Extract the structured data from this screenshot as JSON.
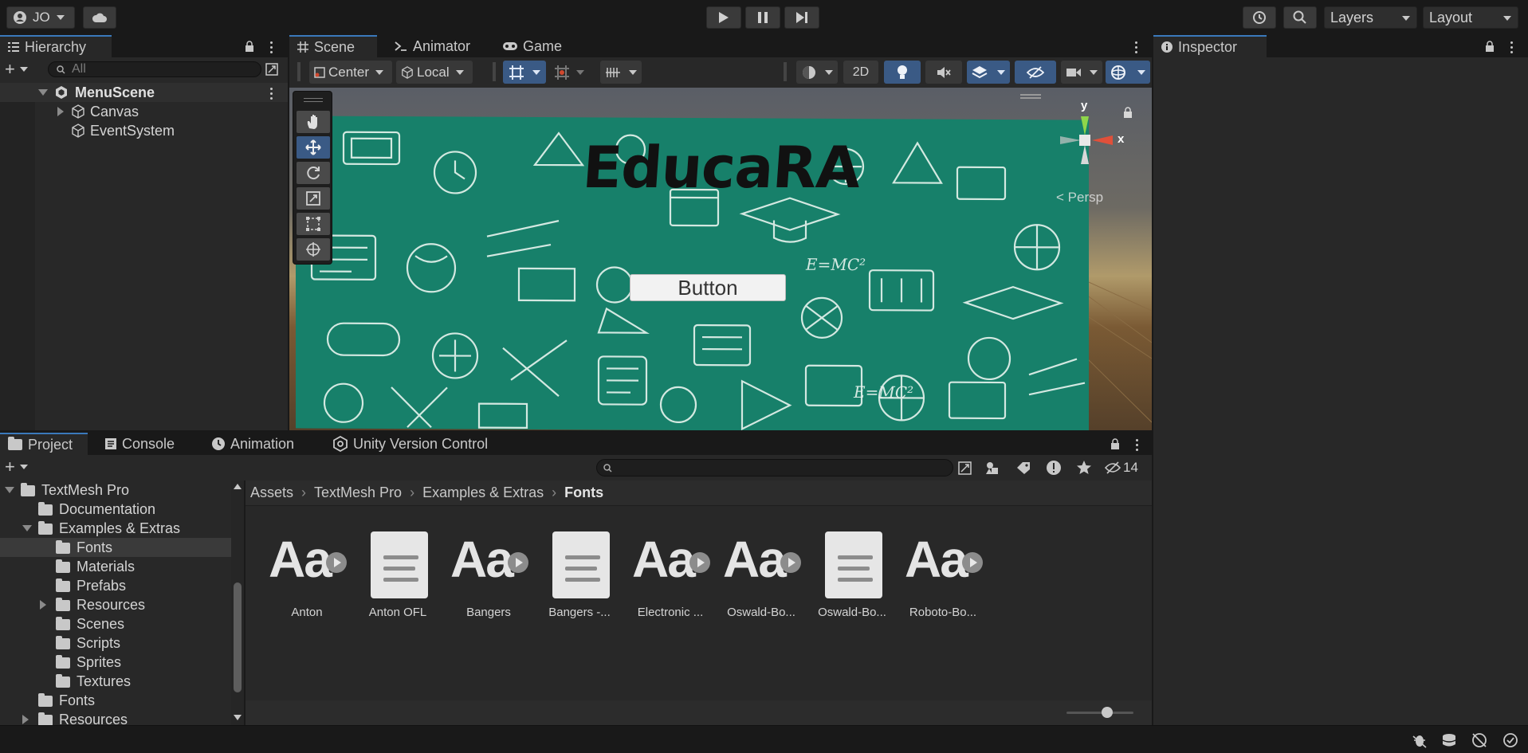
{
  "toolbar": {
    "account_label": "JO",
    "account_icon": "account-icon",
    "cloud_icon": "cloud-icon",
    "play_icon": "play-icon",
    "pause_icon": "pause-icon",
    "step_icon": "step-icon",
    "history_icon": "history-icon",
    "search_icon": "search-icon",
    "layers_label": "Layers",
    "layout_label": "Layout"
  },
  "hierarchy": {
    "tab_label": "Hierarchy",
    "search_placeholder": "All",
    "scene_name": "MenuScene",
    "items": [
      {
        "label": "Canvas",
        "expandable": true
      },
      {
        "label": "EventSystem",
        "expandable": false
      }
    ]
  },
  "scene_tabs": {
    "tabs": [
      {
        "label": "Scene",
        "icon": "grid-icon"
      },
      {
        "label": "Animator",
        "icon": "animator-icon"
      },
      {
        "label": "Game",
        "icon": "gamepad-icon"
      }
    ]
  },
  "scene_toolbar": {
    "pivot_label": "Center",
    "space_label": "Local",
    "mode_2d_label": "2D"
  },
  "scene_view": {
    "title_text": "EducaRA",
    "button_text": "Button",
    "persp_label": "Persp",
    "gizmo_y": "y",
    "gizmo_x": "x",
    "colors": {
      "board": "#17806a",
      "sky": "#b09a6a"
    }
  },
  "inspector": {
    "tab_label": "Inspector"
  },
  "bottom_tabs": {
    "tabs": [
      {
        "label": "Project",
        "icon": "folder-icon"
      },
      {
        "label": "Console",
        "icon": "console-icon"
      },
      {
        "label": "Animation",
        "icon": "clock-icon"
      },
      {
        "label": "Unity Version Control",
        "icon": "version-control-icon"
      }
    ],
    "hidden_count": "14"
  },
  "project_tree": [
    {
      "label": "TextMesh Pro",
      "indent": 1,
      "arrow": "down",
      "open": true
    },
    {
      "label": "Documentation",
      "indent": 2,
      "arrow": "none"
    },
    {
      "label": "Examples & Extras",
      "indent": 2,
      "arrow": "down",
      "open": true
    },
    {
      "label": "Fonts",
      "indent": 3,
      "arrow": "none",
      "selected": true
    },
    {
      "label": "Materials",
      "indent": 3,
      "arrow": "none"
    },
    {
      "label": "Prefabs",
      "indent": 3,
      "arrow": "none"
    },
    {
      "label": "Resources",
      "indent": 3,
      "arrow": "right"
    },
    {
      "label": "Scenes",
      "indent": 3,
      "arrow": "none"
    },
    {
      "label": "Scripts",
      "indent": 3,
      "arrow": "none"
    },
    {
      "label": "Sprites",
      "indent": 3,
      "arrow": "none"
    },
    {
      "label": "Textures",
      "indent": 3,
      "arrow": "none"
    },
    {
      "label": "Fonts",
      "indent": 2,
      "arrow": "none"
    },
    {
      "label": "Resources",
      "indent": 2,
      "arrow": "right"
    }
  ],
  "breadcrumb": [
    "Assets",
    "TextMesh Pro",
    "Examples & Extras",
    "Fonts"
  ],
  "assets": [
    {
      "label": "Anton",
      "kind": "font"
    },
    {
      "label": "Anton OFL",
      "kind": "doc"
    },
    {
      "label": "Bangers",
      "kind": "font"
    },
    {
      "label": "Bangers -...",
      "kind": "doc"
    },
    {
      "label": "Electronic ...",
      "kind": "font"
    },
    {
      "label": "Oswald-Bo...",
      "kind": "font"
    },
    {
      "label": "Oswald-Bo...",
      "kind": "doc"
    },
    {
      "label": "Roboto-Bo...",
      "kind": "font"
    }
  ],
  "font_glyph": "Aa"
}
